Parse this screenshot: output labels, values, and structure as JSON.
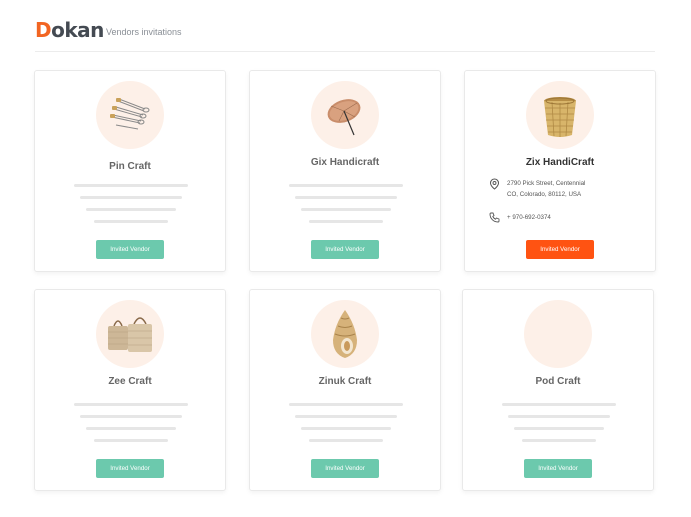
{
  "app": {
    "logo_first": "D",
    "logo_rest": "okan",
    "page_title": "Vendors invitations"
  },
  "colors": {
    "brand": "#f26522",
    "button_invited": "#6cc9ad",
    "button_active": "#ff5312",
    "avatar_bg": "#fdf0e8"
  },
  "vendors": [
    {
      "name": "Pin Craft",
      "image_icon": "safety-pins-icon",
      "button_label": "Invited Vendor"
    },
    {
      "name": "Gix Handicraft",
      "image_icon": "paper-umbrella-icon",
      "button_label": "Invited Vendor"
    },
    {
      "name": "Zix HandiCraft",
      "image_icon": "wicker-basket-icon",
      "button_label": "Invited Vendor",
      "address_line1": "2790 Pick Street, Centennial",
      "address_line2": "CO, Colorado, 80112, USA",
      "phone": "+ 970-692-0374"
    },
    {
      "name": "Zee Craft",
      "image_icon": "woven-bags-icon",
      "button_label": "Invited Vendor"
    },
    {
      "name": "Zinuk Craft",
      "image_icon": "seashell-icon",
      "button_label": "Invited Vendor"
    },
    {
      "name": "Pod Craft",
      "image_icon": "blank-avatar-icon",
      "button_label": "Invited Vendor"
    }
  ]
}
